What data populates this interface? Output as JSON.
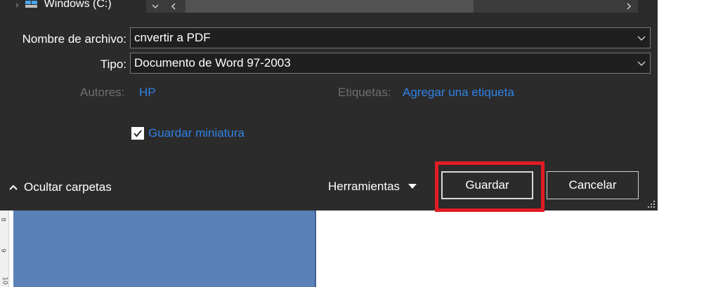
{
  "tree": {
    "drive_label": "Windows (C:)"
  },
  "form": {
    "filename_label": "Nombre de archivo:",
    "filename_value": "cnvertir a PDF",
    "type_label": "Tipo:",
    "type_value": "Documento de Word 97-2003",
    "authors_label": "Autores:",
    "authors_value": "HP",
    "tags_label": "Etiquetas:",
    "tags_value": "Agregar una etiqueta",
    "thumbnail_label": "Guardar miniatura",
    "thumbnail_checked": true
  },
  "footer": {
    "hide_folders_label": "Ocultar carpetas",
    "tools_label": "Herramientas",
    "save_label": "Guardar",
    "cancel_label": "Cancelar"
  },
  "ruler": {
    "marks": [
      "8",
      "9",
      "10"
    ]
  },
  "colors": {
    "dialog_bg": "#2b2b2b",
    "link": "#2f82e6",
    "highlight": "#e01c24",
    "doc_panel": "#5a80b8"
  },
  "icons": {
    "drive": "windows-drive-icon",
    "dropdown": "chevron-down-icon",
    "hide_folders": "chevron-up-icon",
    "tools_menu": "triangle-down-icon",
    "resize": "resize-grip-icon"
  }
}
